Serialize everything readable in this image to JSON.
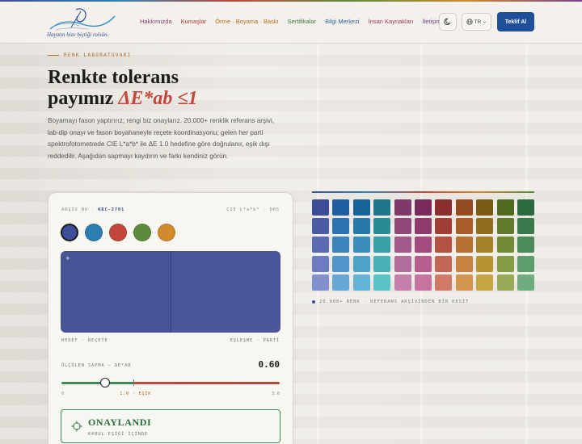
{
  "brand": {
    "slogan": "Hayatın bize biçtiği rolsün."
  },
  "nav": {
    "items": [
      {
        "label": "Hakkımızda"
      },
      {
        "label": "Kumaşlar"
      },
      {
        "label": "Örme · Boyama · Baskı"
      },
      {
        "label": "Sertifikalar"
      },
      {
        "label": "Bilgi Merkezi"
      },
      {
        "label": "İnsan Kaynakları"
      },
      {
        "label": "İletişim"
      }
    ],
    "theme_icon": "moon-icon",
    "lang_icon": "globe-icon",
    "lang_label": "TR",
    "cta_label": "Teklif Al"
  },
  "hero": {
    "eyebrow": "RENK LABORATUVARI",
    "title_line1": "Renkte tolerans",
    "title_line2": "payımız",
    "title_accent": "ΔE*ab ≤1",
    "lead": "Boyamayı fason yaptırırız; rengi biz onaylarız. 20.000+ renklik referans arşivi, lab-dip onayı ve fason boyahaneyle reçete koordinasyonu; gelen her parti spektrofotometrede CIE L*a*b* ile ΔE 1.0 hedefine göre doğrulanır, eşik dışı reddedilir. Aşağıdan sapmayı kaydırın ve farkı kendiniz görün."
  },
  "card": {
    "archive_prefix": "ARŞİV NO ·",
    "archive_code": "KRC-2701",
    "color_space": "CIE L*a*b* · D65",
    "swatches": [
      {
        "color": "#3d4f9a",
        "active": true
      },
      {
        "color": "#2d7fb3",
        "active": false
      },
      {
        "color": "#c2473a",
        "active": false
      },
      {
        "color": "#5a8a3a",
        "active": false
      },
      {
        "color": "#d08a2c",
        "active": false
      }
    ],
    "target_color": "#465395",
    "match_color": "#4a5699",
    "label_left": "HEDEF · REÇETE",
    "label_right": "EŞLEŞME · PARTİ",
    "deviation_label": "ÖLÇÜLEN SAPMA — ΔE*AB",
    "deviation_value": "0.60",
    "deviation_fraction": 0.2,
    "scale_min": "0",
    "scale_threshold": "1.0 · EŞİK",
    "scale_max": "3.0",
    "verdict_icon": "crosshair-icon",
    "verdict_title": "ONAYLANDI",
    "verdict_sub": "KABUL EŞİĞİ İÇİNDE"
  },
  "palette": {
    "caption": "20.000+ RENK · REFERANS ARŞİVİNDEN BİR KESİT",
    "rows": [
      [
        "#3b4d97",
        "#1f5fa1",
        "#15639a",
        "#1f7589",
        "#7d3a6a",
        "#7a2a5a",
        "#8a2e2e",
        "#944a1f",
        "#7a5a12",
        "#4f6a1f",
        "#2a6a3f",
        "#1a6a3a"
      ],
      [
        "#4a5ca5",
        "#2d72b0",
        "#2878a8",
        "#2a8a96",
        "#8f4878",
        "#8e3a6a",
        "#a03e33",
        "#a85d28",
        "#8f6e1d",
        "#61792a",
        "#397a4a",
        "#2a7a48"
      ],
      [
        "#5a6cb3",
        "#3d84bd",
        "#3a8fba",
        "#37a0a8",
        "#a25a8a",
        "#a34b7c",
        "#b35242",
        "#b86f34",
        "#a48229",
        "#738a36",
        "#4a8b5a",
        "#3a8a5a"
      ],
      [
        "#6d7cc0",
        "#5195c9",
        "#4ea2c8",
        "#48b2b8",
        "#b26c9b",
        "#b65f8e",
        "#c26655",
        "#c7823f",
        "#b69434",
        "#859b44",
        "#5d9c6b",
        "#4f9a6a"
      ],
      [
        "#8290cc",
        "#68a7d4",
        "#65b3d4",
        "#5ac3c6",
        "#c280ab",
        "#c574a0",
        "#cf7a68",
        "#d2954f",
        "#c6a543",
        "#97ab56",
        "#70ac7d",
        "#66aa7c"
      ]
    ]
  }
}
